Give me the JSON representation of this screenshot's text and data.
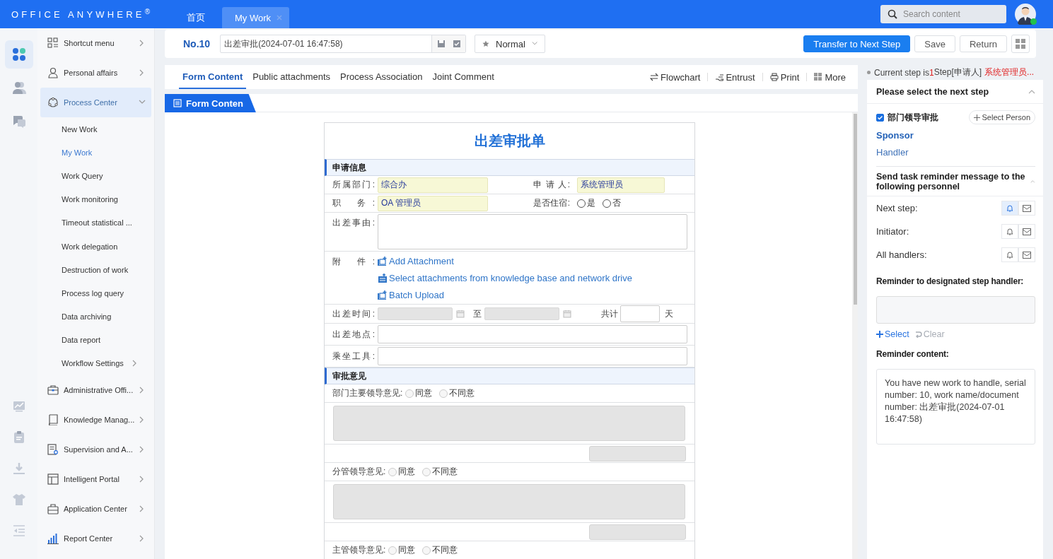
{
  "header": {
    "logo": "OFFICE ANYWHERE$^{®}$",
    "tabs": [
      {
        "label": "首页",
        "selected": false,
        "closable": false
      },
      {
        "label": "My Work",
        "selected": true,
        "closable": true
      }
    ],
    "search": {
      "placeholder": "Search content"
    },
    "user": {
      "online": true
    }
  },
  "icon_rail": [
    {
      "kind": "apps",
      "selected": true
    },
    {
      "kind": "people",
      "selected": false
    },
    {
      "kind": "chat",
      "selected": false
    },
    {
      "kind": "chart",
      "selected": false
    },
    {
      "kind": "clipboard",
      "selected": false
    },
    {
      "kind": "download",
      "selected": false
    },
    {
      "kind": "shirt",
      "selected": false
    },
    {
      "kind": "collapse",
      "selected": false
    }
  ],
  "menu": [
    {
      "label": "Shortcut menu",
      "selected": false,
      "expanded": false
    },
    {
      "label": "Personal affairs",
      "selected": false,
      "expanded": false
    },
    {
      "label": "Process Center",
      "selected": true,
      "expanded": true,
      "children": [
        {
          "label": "New Work",
          "selected": false
        },
        {
          "label": "My Work",
          "selected": true
        },
        {
          "label": "Work Query",
          "selected": false
        },
        {
          "label": "Work monitoring",
          "selected": false
        },
        {
          "label": "Timeout statistical ...",
          "selected": false
        },
        {
          "label": "Work delegation",
          "selected": false
        },
        {
          "label": "Destruction of work",
          "selected": false
        },
        {
          "label": "Process log query",
          "selected": false
        },
        {
          "label": "Data archiving",
          "selected": false
        },
        {
          "label": "Data report",
          "selected": false
        },
        {
          "label": "Workflow Settings",
          "selected": false,
          "submenu": true
        }
      ]
    },
    {
      "label": "Administrative Offi...",
      "selected": false,
      "expanded": false
    },
    {
      "label": "Knowledge Manag...",
      "selected": false,
      "expanded": false
    },
    {
      "label": "Supervision and A...",
      "selected": false,
      "expanded": false
    },
    {
      "label": "Intelligent Portal",
      "selected": false,
      "expanded": false
    },
    {
      "label": "Application Center",
      "selected": false,
      "expanded": false
    },
    {
      "label": "Report Center",
      "selected": false,
      "expanded": false
    }
  ],
  "toolbar": {
    "number": "No.10",
    "title": "出差审批(2024-07-01 16:47:58)",
    "priority": "Normal",
    "buttons": [
      {
        "label": "Transfer to Next Step",
        "kind": "primary"
      },
      {
        "label": "Save",
        "kind": "default"
      },
      {
        "label": "Return",
        "kind": "default"
      }
    ]
  },
  "form_tabs": [
    {
      "label": "Form Content",
      "selected": true
    },
    {
      "label": "Public attachments",
      "selected": false
    },
    {
      "label": "Process Association",
      "selected": false
    },
    {
      "label": "Joint Comment",
      "selected": false
    }
  ],
  "form_actions": [
    "Flowchart",
    "Entrust",
    "Print",
    "More"
  ],
  "form_tag": "Form Conten",
  "form": {
    "title": "出差审批单",
    "rows": [
      {
        "kind": "section",
        "label": "申请信息"
      },
      {
        "kind": "pair",
        "label": "所属部门:",
        "value": "综合办",
        "label2": "申 请 人:",
        "value2": "系统管理员"
      },
      {
        "kind": "pair_radio",
        "label": "职 务:",
        "value": "OA 管理员",
        "label2": "是否住宿:",
        "options": [
          {
            "label": "是",
            "selected": false
          },
          {
            "label": "否",
            "selected": false
          }
        ]
      },
      {
        "kind": "textarea",
        "label": "出差事由:"
      },
      {
        "kind": "attachments",
        "label": "附 件:",
        "links": [
          "Add Attachment",
          "Select attachments from knowledge base and network drive",
          "Batch Upload"
        ]
      },
      {
        "kind": "daterange",
        "label": "出差时间:",
        "separator": "至",
        "total_label": "共计",
        "unit": "天"
      },
      {
        "kind": "input",
        "label": "出差地点:"
      },
      {
        "kind": "input",
        "label": "乘坐工具:"
      },
      {
        "kind": "section",
        "label": "审批意见"
      },
      {
        "kind": "opinion",
        "label": "部门主要领导意见:",
        "options": [
          {
            "label": "同意",
            "selected": false
          },
          {
            "label": "不同意",
            "selected": false
          }
        ]
      },
      {
        "kind": "opinion",
        "label": "分管领导意见:",
        "options": [
          {
            "label": "同意",
            "selected": false
          },
          {
            "label": "不同意",
            "selected": false
          }
        ]
      },
      {
        "kind": "opinion",
        "label": "主管领导意见:",
        "options": [
          {
            "label": "同意",
            "selected": false
          },
          {
            "label": "不同意",
            "selected": false
          }
        ]
      }
    ]
  },
  "current_step": {
    "prefix": "Current step is",
    "step": "1",
    "suffix": "Step[申请人]",
    "user": "系统管理员..."
  },
  "next_step": {
    "title": "Please select the next step",
    "expanded": true,
    "steps": [
      {
        "label": "部门领导审批",
        "checked": true
      }
    ],
    "select_person": "Select Person",
    "roles": [
      {
        "label": "Sponsor",
        "selected": true
      },
      {
        "label": "Handler",
        "selected": false
      }
    ]
  },
  "reminders": {
    "title": "Send task reminder message to the following personnel",
    "expanded": true,
    "rows": [
      {
        "label": "Next step:",
        "bell": true,
        "mail": false
      },
      {
        "label": "Initiator:",
        "bell": false,
        "mail": false
      },
      {
        "label": "All handlers:",
        "bell": false,
        "mail": false
      }
    ]
  },
  "designated": {
    "title": "Reminder to designated step handler:",
    "actions": [
      {
        "label": "Select",
        "kind": "add",
        "disabled": false
      },
      {
        "label": "Clear",
        "kind": "clear",
        "disabled": true
      }
    ]
  },
  "reminder_content": {
    "title": "Reminder content:",
    "value": "You have new work to handle, serial number: 10, work name/document number: 出差审批(2024-07-01 16:47:58)"
  }
}
